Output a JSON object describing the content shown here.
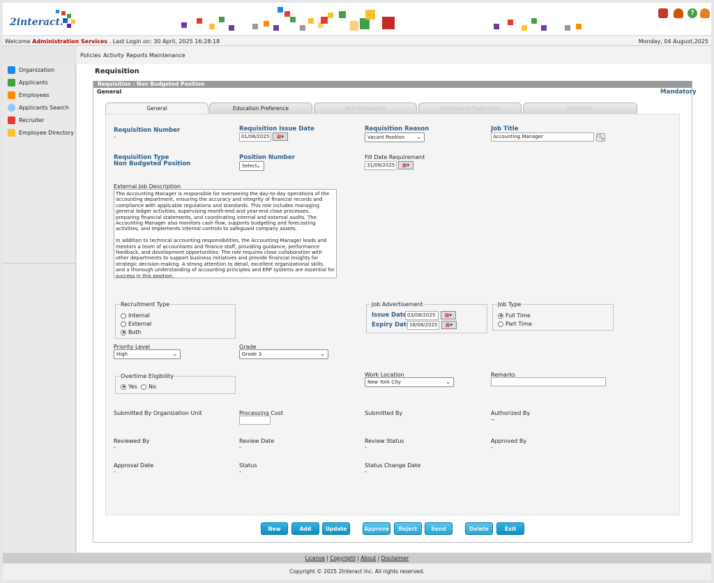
{
  "header": {
    "logo_text": "2interact."
  },
  "welcome": {
    "prefix": "Welcome ",
    "user": "Administration Services",
    "login": " . Last Login on: 30 April, 2025 16:28:18",
    "date": "Monday, 04 August,2025"
  },
  "menu": [
    "Policies",
    "Activity",
    "Reports",
    "Maintenance"
  ],
  "sidebar": [
    "Organization",
    "Applicants",
    "Employees",
    "Applicants Search",
    "Recruiter",
    "Employee Directory"
  ],
  "page": {
    "title": "Requisition",
    "panel_header": "Requisition : Non Budgeted Position",
    "section": "General",
    "mandatory": "Mandatory"
  },
  "tabs": [
    "General",
    "Education Preference",
    "Skill Preference",
    "Experience Preference",
    "Questions"
  ],
  "form": {
    "req_number_label": "Requisition Number",
    "req_number_value": "-",
    "issue_date_label": "Requisition Issue Date",
    "issue_date_value": "01/08/2025",
    "reason_label": "Requisition Reason",
    "reason_value": "Vacant Position",
    "job_title_label": "Job Title",
    "job_title_value": "Accounting Manager",
    "req_type_label": "Requisition Type",
    "req_type_value": "Non Budgeted Position",
    "position_label": "Position Number",
    "position_value": "Select",
    "fill_date_label": "Fill Date Requirement",
    "fill_date_value": "31/08/2025",
    "ext_desc_label": "External Job Description",
    "ext_desc": "The Accounting Manager is responsible for overseeing the day-to-day operations of the accounting department, ensuring the accuracy and integrity of financial records and compliance with applicable regulations and standards. This role includes managing general ledger activities, supervising month-end and year-end close processes, preparing financial statements, and coordinating internal and external audits. The Accounting Manager also monitors cash flow, supports budgeting and forecasting activities, and implements internal controls to safeguard company assets.\n\nIn addition to technical accounting responsibilities, the Accounting Manager leads and mentors a team of accountants and finance staff, providing guidance, performance feedback, and development opportunities. The role requires close collaboration with other departments to support business initiatives and provide financial insights for strategic decision-making. A strong attention to detail, excellent organizational skills, and a thorough understanding of accounting principles and ERP systems are essential for success in this position.",
    "recruit_type_label": "Recruitment Type",
    "rt_internal": "Internal",
    "rt_external": "External",
    "rt_both": "Both",
    "job_adv_label": "Job Advertisement",
    "adv_issue_label": "Issue Date",
    "adv_issue_value": "03/08/2025",
    "adv_expiry_label": "Expiry Date",
    "adv_expiry_value": "18/08/2025",
    "job_type_label": "Job Type",
    "jt_full": "Full Time",
    "jt_part": "Part Time",
    "priority_label": "Priority Level",
    "priority_value": "High",
    "grade_label": "Grade",
    "grade_value": "Grade 3",
    "overtime_label": "Overtime Eligibility",
    "ot_yes": "Yes",
    "ot_no": "No",
    "work_loc_label": "Work Location",
    "work_loc_value": "New York City",
    "remarks_label": "Remarks",
    "sub_org_label": "Submitted By Organization Unit",
    "proc_cost_label": "Processing Cost",
    "submitted_by_label": "Submitted By",
    "authorized_label": "Authorized By",
    "authorized_value": "--",
    "reviewed_label": "Reviewed By",
    "reviewed_value": "-",
    "review_date_label": "Review Date",
    "review_date_value": "-",
    "review_status_label": "Review Status",
    "review_status_value": "-",
    "approved_label": "Approved By",
    "approved_value": "-",
    "approval_date_label": "Approval Date",
    "approval_date_value": "-",
    "status_label": "Status",
    "status_value": "-",
    "status_change_label": "Status Change Date",
    "status_change_value": "-"
  },
  "buttons": [
    "New",
    "Add",
    "Update",
    "Approve",
    "Reject",
    "Send",
    "Delete",
    "Exit"
  ],
  "footer": {
    "license": "License",
    "copyright": "Copyright",
    "about": "About",
    "disclaimer": "Disclaimer",
    "sep": " | ",
    "copy": "Copyright © 2025 2Interact Inc. All rights reserved."
  }
}
